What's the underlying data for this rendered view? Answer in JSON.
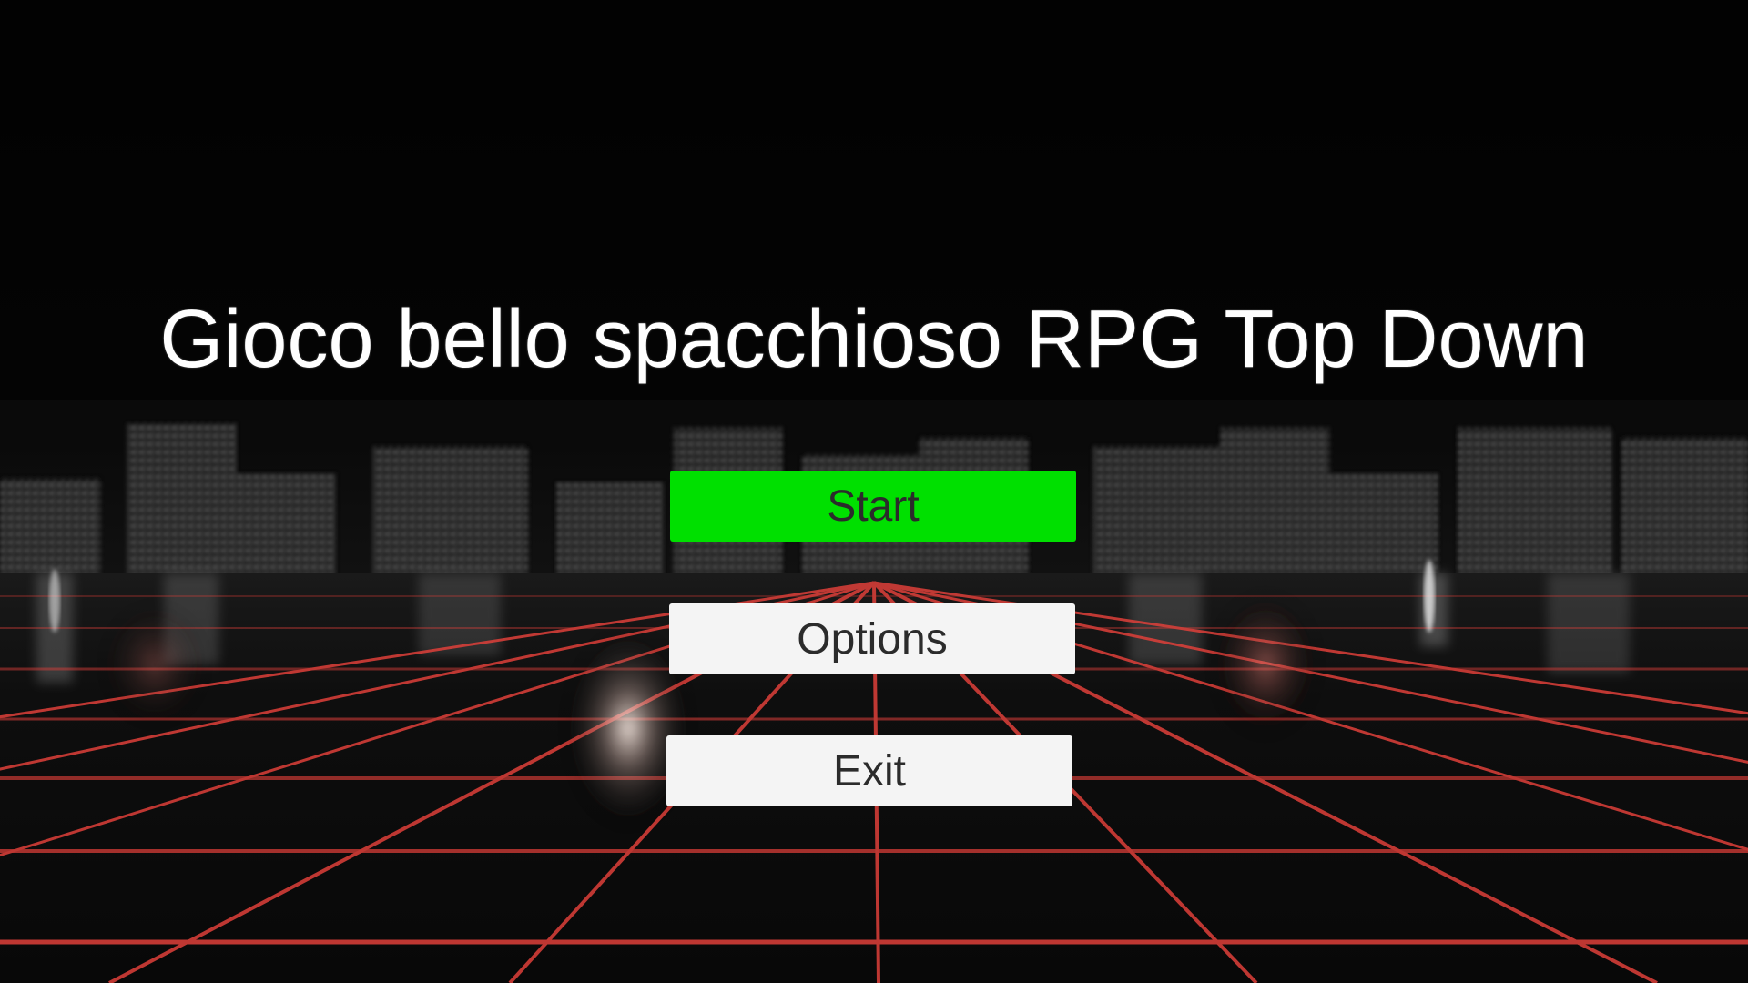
{
  "title": "Gioco bello spacchioso RPG Top Down",
  "menu": {
    "start_label": "Start",
    "options_label": "Options",
    "exit_label": "Exit",
    "selected": "Start"
  },
  "colors": {
    "selected_button": "#00e000",
    "button": "#f4f4f4",
    "button_text": "#2b2b2b",
    "title_text": "#ffffff",
    "grid": "#e0403a",
    "background": "#040404"
  }
}
